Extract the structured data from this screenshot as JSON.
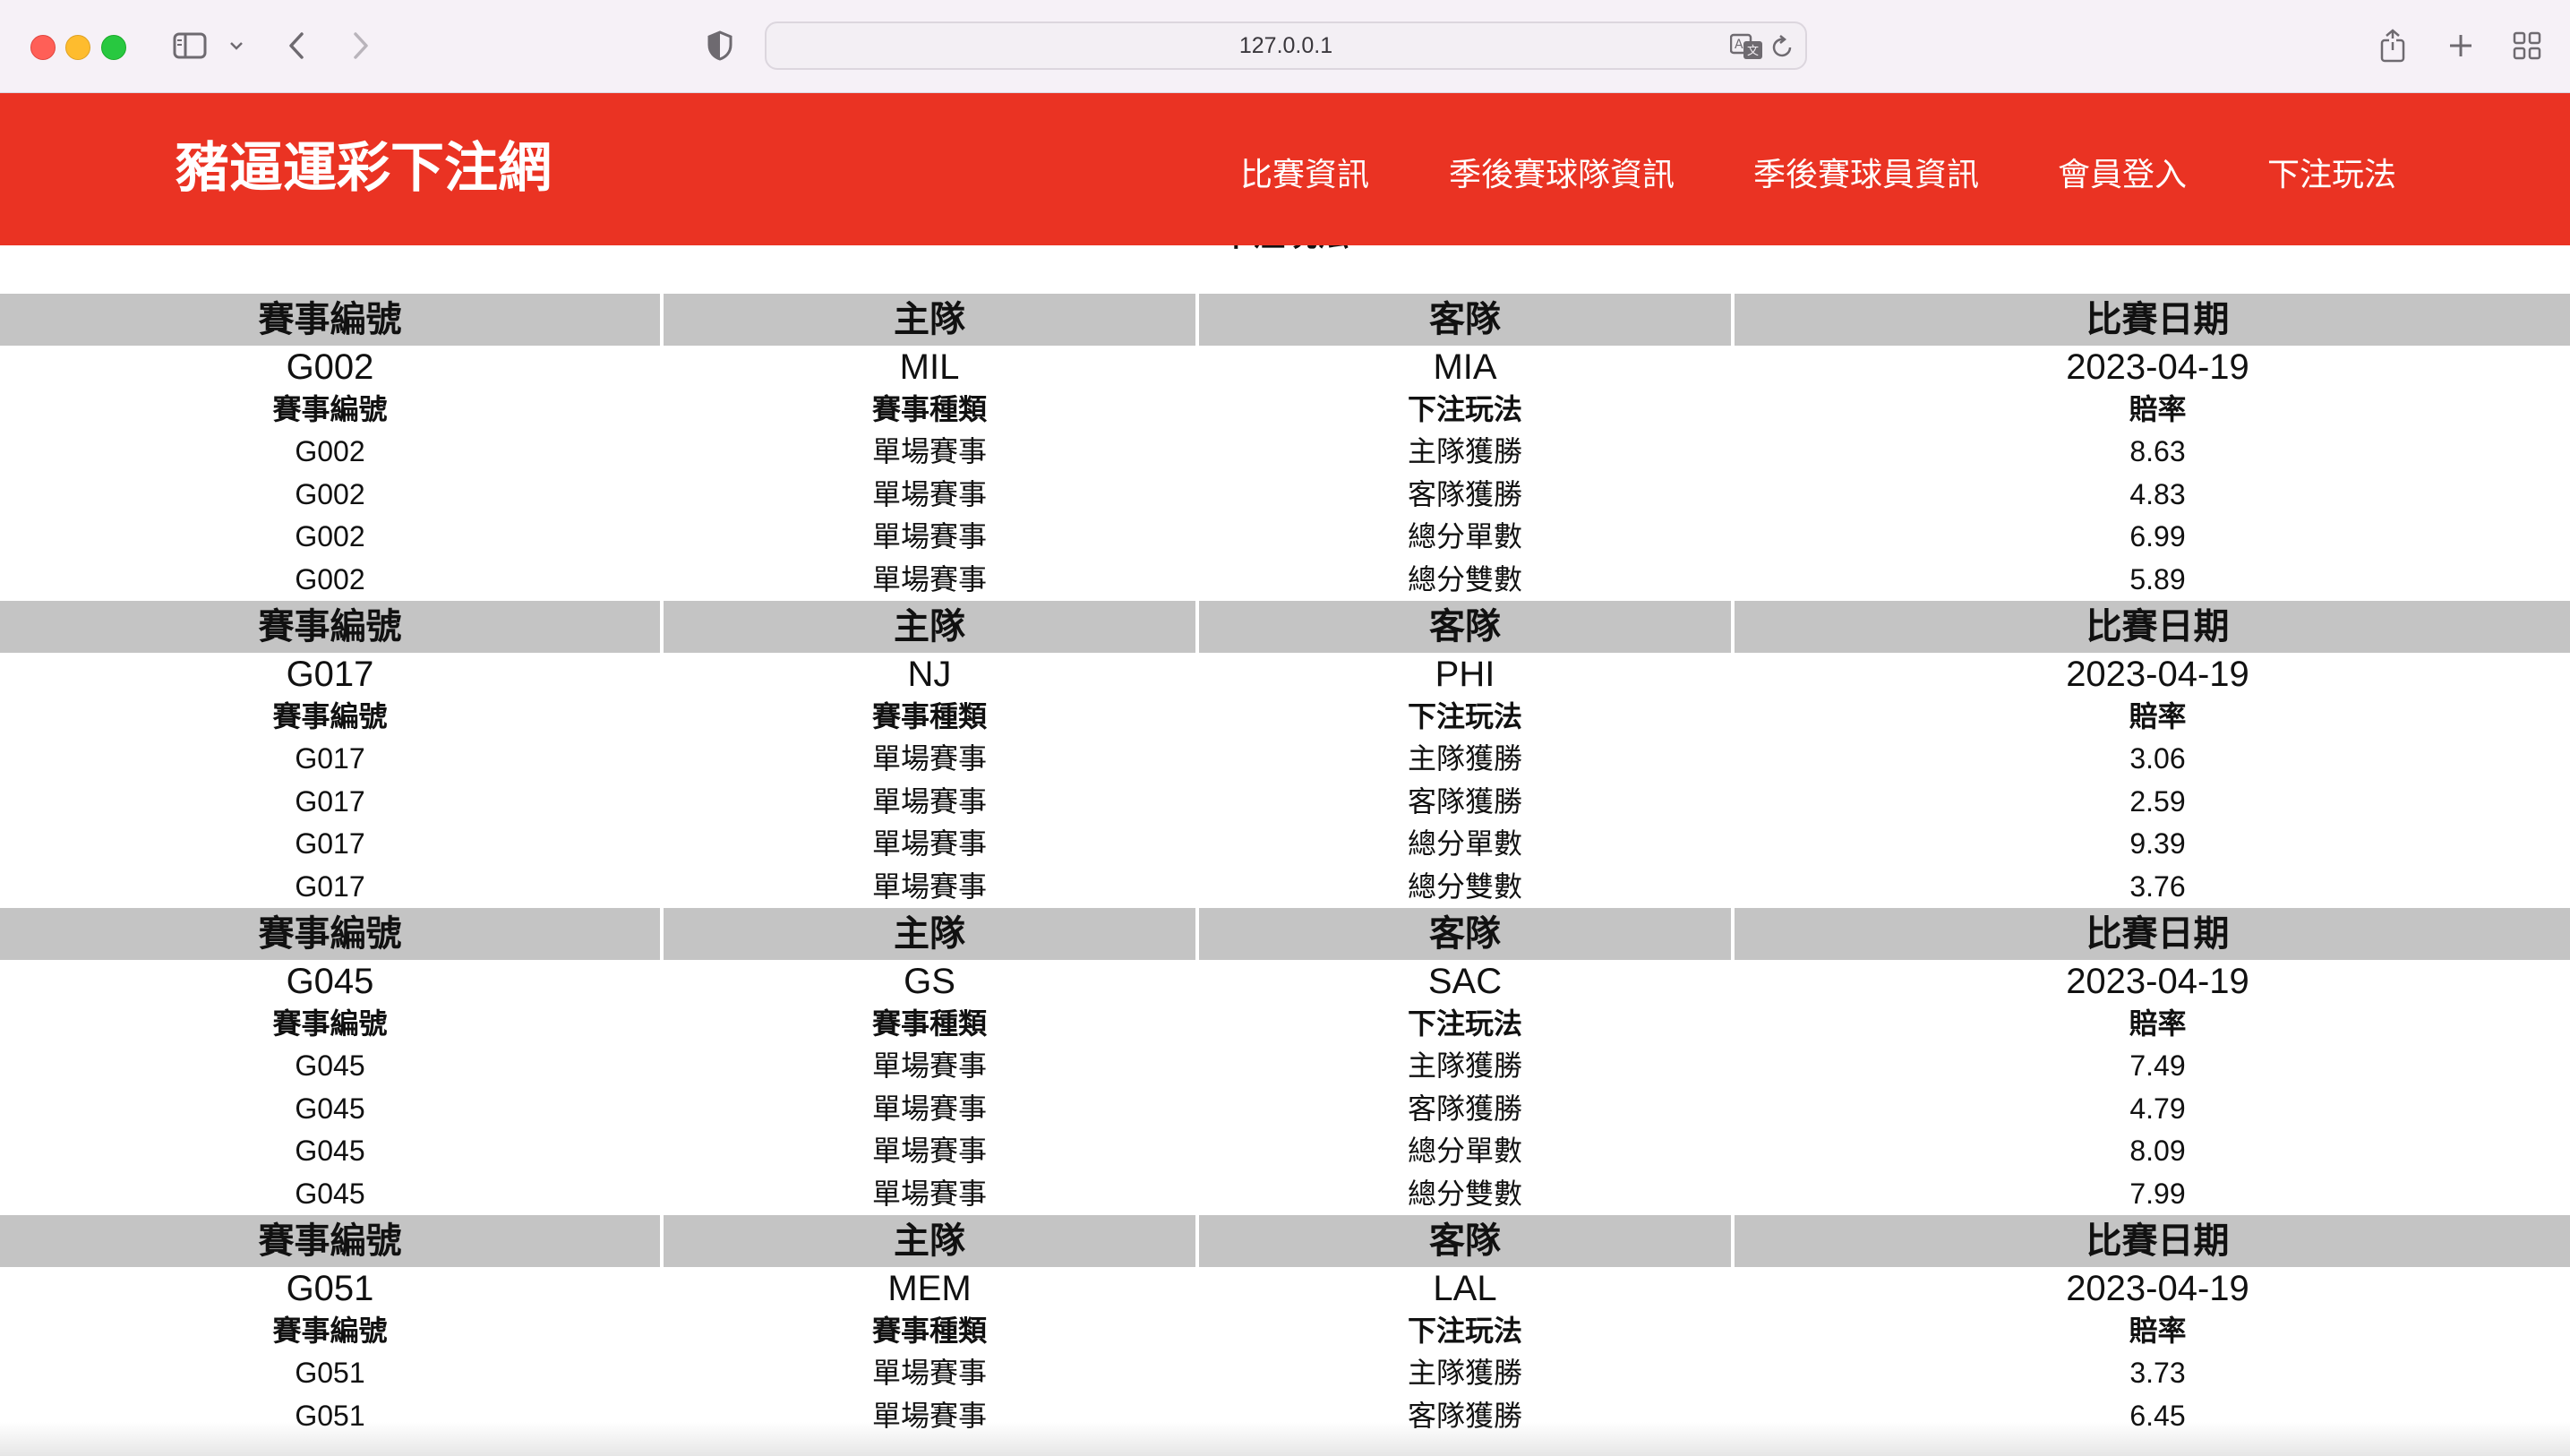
{
  "browser": {
    "url": "127.0.0.1"
  },
  "header": {
    "brand": "豬逼運彩下注網",
    "nav": [
      "比賽資訊",
      "季後賽球隊資訊",
      "季後賽球員資訊",
      "會員登入",
      "下注玩法"
    ]
  },
  "page_title": "下注玩法",
  "table": {
    "game_headers": [
      "賽事編號",
      "主隊",
      "客隊",
      "比賽日期"
    ],
    "bet_headers": [
      "賽事編號",
      "賽事種類",
      "下注玩法",
      "賠率"
    ],
    "games": [
      {
        "id": "G002",
        "home": "MIL",
        "away": "MIA",
        "date": "2023-04-19",
        "bets": [
          {
            "id": "G002",
            "type": "單場賽事",
            "play": "主隊獲勝",
            "odds": "8.63"
          },
          {
            "id": "G002",
            "type": "單場賽事",
            "play": "客隊獲勝",
            "odds": "4.83"
          },
          {
            "id": "G002",
            "type": "單場賽事",
            "play": "總分單數",
            "odds": "6.99"
          },
          {
            "id": "G002",
            "type": "單場賽事",
            "play": "總分雙數",
            "odds": "5.89"
          }
        ]
      },
      {
        "id": "G017",
        "home": "NJ",
        "away": "PHI",
        "date": "2023-04-19",
        "bets": [
          {
            "id": "G017",
            "type": "單場賽事",
            "play": "主隊獲勝",
            "odds": "3.06"
          },
          {
            "id": "G017",
            "type": "單場賽事",
            "play": "客隊獲勝",
            "odds": "2.59"
          },
          {
            "id": "G017",
            "type": "單場賽事",
            "play": "總分單數",
            "odds": "9.39"
          },
          {
            "id": "G017",
            "type": "單場賽事",
            "play": "總分雙數",
            "odds": "3.76"
          }
        ]
      },
      {
        "id": "G045",
        "home": "GS",
        "away": "SAC",
        "date": "2023-04-19",
        "bets": [
          {
            "id": "G045",
            "type": "單場賽事",
            "play": "主隊獲勝",
            "odds": "7.49"
          },
          {
            "id": "G045",
            "type": "單場賽事",
            "play": "客隊獲勝",
            "odds": "4.79"
          },
          {
            "id": "G045",
            "type": "單場賽事",
            "play": "總分單數",
            "odds": "8.09"
          },
          {
            "id": "G045",
            "type": "單場賽事",
            "play": "總分雙數",
            "odds": "7.99"
          }
        ]
      },
      {
        "id": "G051",
        "home": "MEM",
        "away": "LAL",
        "date": "2023-04-19",
        "bets": [
          {
            "id": "G051",
            "type": "單場賽事",
            "play": "主隊獲勝",
            "odds": "3.73"
          },
          {
            "id": "G051",
            "type": "單場賽事",
            "play": "客隊獲勝",
            "odds": "6.45"
          }
        ]
      }
    ]
  },
  "colors": {
    "header_bg": "#ea3323",
    "table_header_bg": "#c4c4c4",
    "chrome_bg": "#f6f1f7"
  }
}
